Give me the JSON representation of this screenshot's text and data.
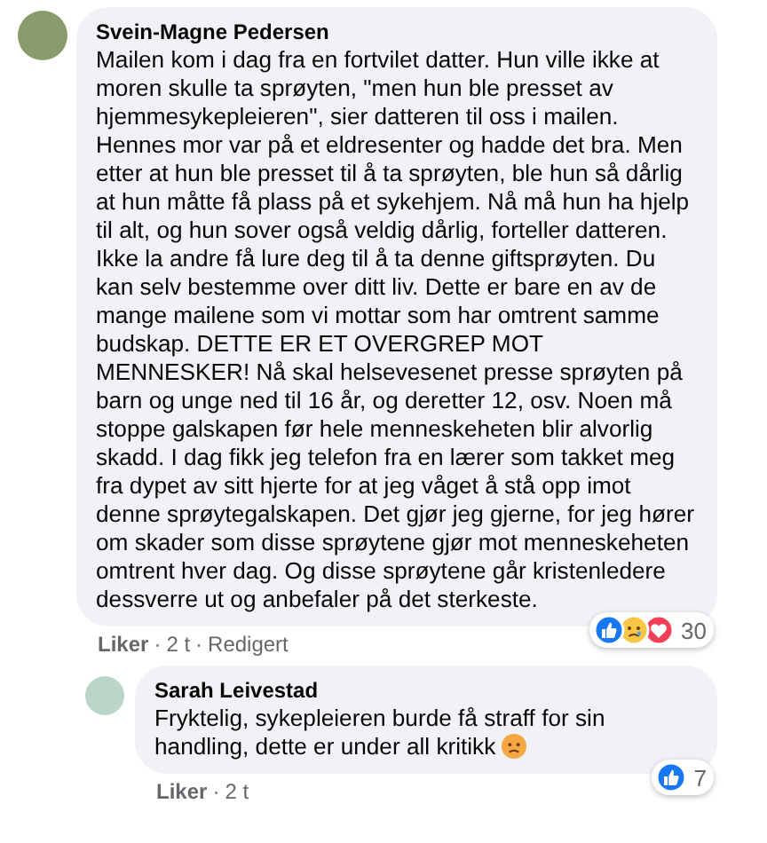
{
  "separator": "·",
  "comments": [
    {
      "author": "Svein-Magne Pedersen",
      "text": "Mailen kom i dag fra en fortvilet datter. Hun ville ikke at moren skulle ta sprøyten, \"men hun ble presset av hjemmesykepleieren\", sier datteren til oss i mailen. Hennes mor var på et eldresenter og hadde det bra. Men etter at hun ble presset til å ta sprøyten, ble hun så dårlig at hun måtte få plass på et sykehjem. Nå må hun ha hjelp til alt, og hun sover også veldig dårlig, forteller datteren. Ikke la andre få lure deg til å ta denne giftsprøyten. Du kan selv bestemme over ditt liv. Dette er bare en av de mange mailene som vi mottar som har omtrent samme budskap. DETTE ER ET OVERGREP MOT MENNESKER! Nå skal helsevesenet presse sprøyten på barn og unge ned til 16 år, og deretter 12, osv. Noen må stoppe galskapen før hele menneskeheten blir alvorlig skadd. I dag fikk jeg telefon fra en lærer som takket meg fra dypet av sitt hjerte for at jeg våget å stå opp imot denne sprøytegalskapen. Det gjør jeg gjerne, for jeg hører om skader som disse sprøytene gjør mot menneskeheten omtrent hver dag. Og disse sprøytene går kristenledere dessverre ut og anbefaler på det sterkeste.",
      "reply": false,
      "meta": [
        "Liker",
        "2 t",
        "Redigert"
      ],
      "reactions": {
        "icons": [
          {
            "kind": "like"
          },
          {
            "kind": "sad"
          },
          {
            "kind": "love"
          }
        ],
        "count": "30"
      }
    },
    {
      "author": "Sarah Leivestad",
      "text": "Fryktelig, sykepleieren burde få straff for sin handling, dette er under all kritikk",
      "trailing_emoji": {
        "kind": "angry"
      },
      "reply": true,
      "meta": [
        "Liker",
        "2 t"
      ],
      "reactions": {
        "icons": [
          {
            "kind": "like"
          }
        ],
        "count": "7"
      }
    }
  ]
}
